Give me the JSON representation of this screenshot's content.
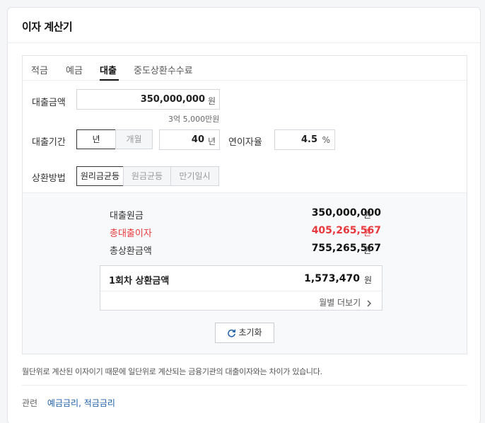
{
  "card": {
    "title": "이자 계산기"
  },
  "tabs": [
    {
      "label": "적금",
      "active": false
    },
    {
      "label": "예금",
      "active": false
    },
    {
      "label": "대출",
      "active": true
    },
    {
      "label": "중도상환수수료",
      "active": false
    }
  ],
  "form": {
    "loan_amount": {
      "label": "대출금액",
      "value": "350,000,000",
      "unit": "원",
      "hint": "3억 5,000만원"
    },
    "loan_period": {
      "label": "대출기간",
      "unit_options": [
        "년",
        "개월"
      ],
      "selected_unit": "년",
      "value": "40",
      "unit": "년"
    },
    "interest_rate": {
      "label": "연이자율",
      "value": "4.5",
      "unit": "%"
    },
    "repayment": {
      "label": "상환방법",
      "options": [
        "원리금균등",
        "원금균등",
        "만기일시"
      ],
      "selected": "원리금균등"
    }
  },
  "results": {
    "principal": {
      "label": "대출원금",
      "value": "350,000,000",
      "unit": "원"
    },
    "total_interest": {
      "label": "총대출이자",
      "value": "405,265,567",
      "unit": "원"
    },
    "total_repayment": {
      "label": "총상환금액",
      "value": "755,265,567",
      "unit": "원"
    },
    "first_installment": {
      "label": "1회차 상환금액",
      "value": "1,573,470",
      "unit": "원"
    },
    "more_link": "월별 더보기"
  },
  "reset_button": "초기화",
  "notice": "월단위로 계산된 이자이기 때문에 일단위로 계산되는 금융기관의 대출이자와는 차이가 있습니다.",
  "related": {
    "label": "관련",
    "links": [
      "예금금리",
      "적금금리"
    ],
    "separator": ","
  },
  "colors": {
    "accent_red": "#e8383d",
    "link_blue": "#1c5ea8",
    "active_tab": "#111111"
  }
}
